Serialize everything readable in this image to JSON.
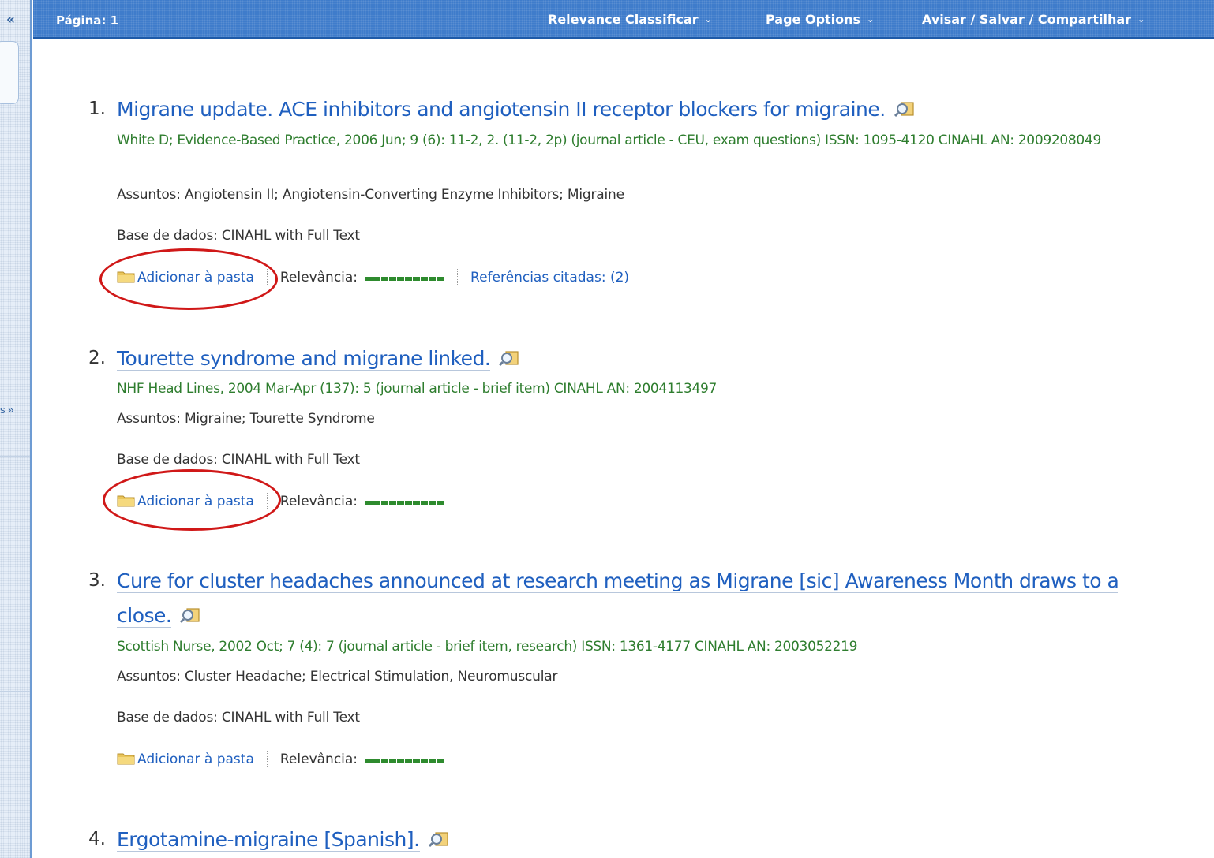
{
  "sidebar": {
    "collapse_label": "«",
    "more_label": "s »"
  },
  "toolbar": {
    "page_label": "Página: 1",
    "sort_label": "Relevance Classificar",
    "page_options_label": "Page Options",
    "share_label": "Avisar / Salvar / Compartilhar"
  },
  "labels": {
    "subjects_prefix": "Assuntos:",
    "database_prefix": "Base de dados:",
    "add_to_folder": "Adicionar à pasta",
    "relevance": "Relevância:"
  },
  "results": [
    {
      "number": "1.",
      "title": "Migrane update. ACE inhibitors and angiotensin II receptor blockers for migraine.",
      "citation": "White D; Evidence-Based Practice, 2006 Jun; 9 (6): 11-2, 2. (11-2, 2p) (journal article - CEU, exam questions) ISSN: 1095-4120 CINAHL AN: 2009208049",
      "subjects": "Angiotensin II; Angiotensin-Converting Enzyme Inhibitors; Migraine",
      "database": "CINAHL with Full Text",
      "cited_refs": "Referências citadas: (2)",
      "highlighted": true
    },
    {
      "number": "2.",
      "title": "Tourette syndrome and migrane linked.",
      "citation": "NHF Head Lines, 2004 Mar-Apr (137): 5 (journal article - brief item) CINAHL AN: 2004113497",
      "subjects": "Migraine; Tourette Syndrome",
      "database": "CINAHL with Full Text",
      "highlighted": true
    },
    {
      "number": "3.",
      "title": "Cure for cluster headaches announced at research meeting as Migrane [sic] Awareness Month draws to a close.",
      "citation": "Scottish Nurse, 2002 Oct; 7 (4): 7 (journal article - brief item, research) ISSN: 1361-4177 CINAHL AN: 2003052219",
      "subjects": "Cluster Headache; Electrical Stimulation, Neuromuscular",
      "database": "CINAHL with Full Text",
      "highlighted": false
    },
    {
      "number": "4.",
      "title": "Ergotamine-migraine [Spanish].",
      "highlighted": false
    }
  ],
  "colors": {
    "link": "#1f5fbf",
    "citation": "#2e7d2e",
    "toolbar": "#3f7ccb",
    "highlight": "#d01818"
  }
}
